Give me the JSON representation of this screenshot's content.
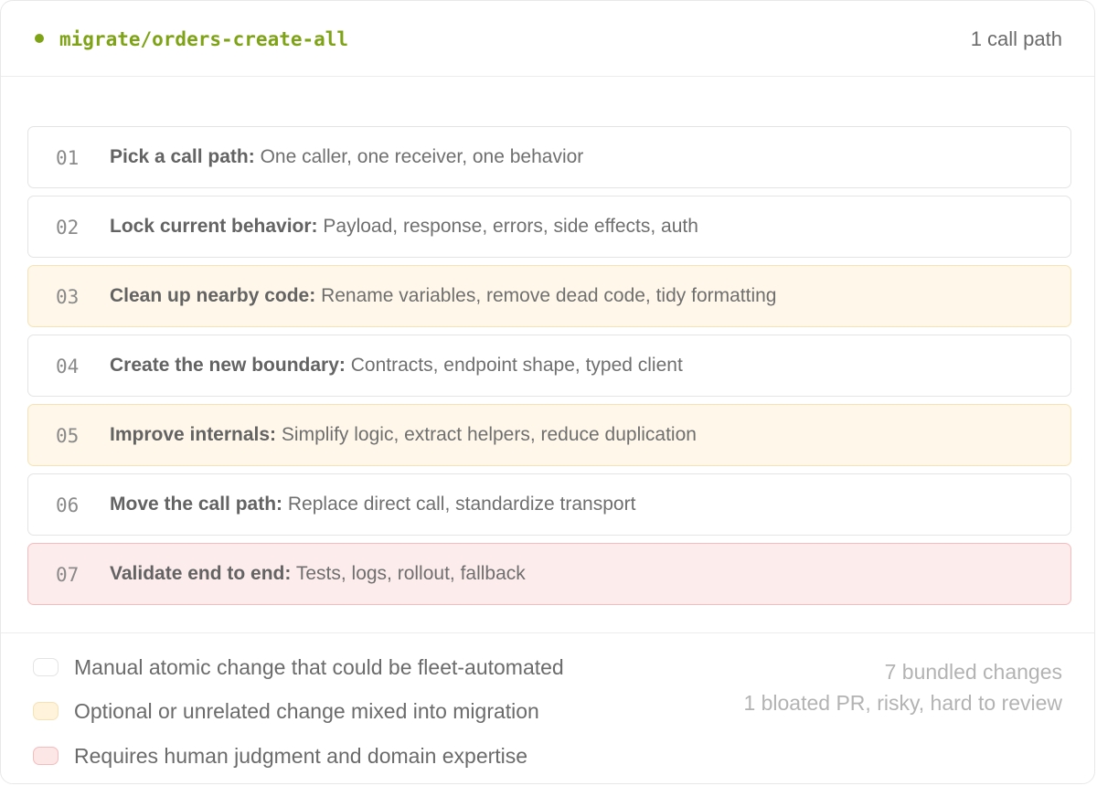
{
  "header": {
    "branch": "migrate/orders-create-all",
    "path_count": "1 call path",
    "accent_color": "#7fa317"
  },
  "steps": [
    {
      "num": "01",
      "title": "Pick a call path:",
      "desc": "One caller, one receiver, one behavior",
      "kind": "manual"
    },
    {
      "num": "02",
      "title": "Lock current behavior:",
      "desc": "Payload, response, errors, side effects, auth",
      "kind": "manual"
    },
    {
      "num": "03",
      "title": "Clean up nearby code:",
      "desc": "Rename variables, remove dead code, tidy formatting",
      "kind": "optional"
    },
    {
      "num": "04",
      "title": "Create the new boundary:",
      "desc": "Contracts, endpoint shape, typed client",
      "kind": "manual"
    },
    {
      "num": "05",
      "title": "Improve internals:",
      "desc": "Simplify logic, extract helpers, reduce duplication",
      "kind": "optional"
    },
    {
      "num": "06",
      "title": "Move the call path:",
      "desc": "Replace direct call, standardize transport",
      "kind": "manual"
    },
    {
      "num": "07",
      "title": "Validate end to end:",
      "desc": "Tests, logs, rollout, fallback",
      "kind": "judgment"
    }
  ],
  "legend": [
    {
      "label": "Manual atomic change that could be fleet-automated",
      "kind": "manual",
      "color": "#ffffff"
    },
    {
      "label": "Optional or unrelated change mixed into migration",
      "kind": "optional",
      "color": "#fff3dc"
    },
    {
      "label": "Requires human judgment and domain expertise",
      "kind": "judgment",
      "color": "#fde6e6"
    }
  ],
  "summary": {
    "line1": "7 bundled changes",
    "line2": "1 bloated PR, risky, hard to review"
  }
}
